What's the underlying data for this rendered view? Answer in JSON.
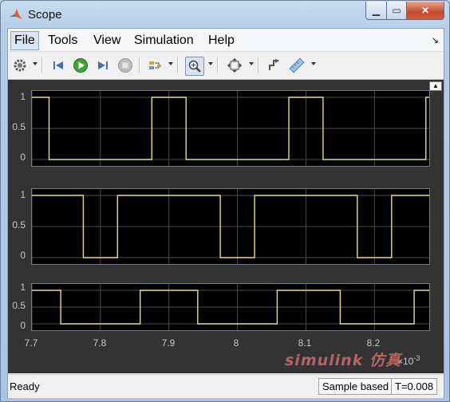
{
  "window": {
    "title": "Scope",
    "app_icon": "matlab-icon"
  },
  "menu": [
    "File",
    "Tools",
    "View",
    "Simulation",
    "Help"
  ],
  "toolbar": {
    "icons": [
      "gear-icon",
      "step-back-icon",
      "run-icon",
      "step-forward-icon",
      "stop-icon",
      "signal-icon",
      "zoom-in-icon",
      "autoscale-icon",
      "highlight-icon",
      "measure-icon"
    ]
  },
  "axes": {
    "y_ticks": [
      "1",
      "0.5",
      "0"
    ],
    "x_ticks": [
      "7.7",
      "7.8",
      "7.9",
      "8",
      "8.1",
      "8.2"
    ],
    "x_exponent": "×10",
    "x_exponent_power": "-3"
  },
  "colors": {
    "signal": "#e6df7a",
    "plot_bg": "#000000",
    "panel_bg": "#333333",
    "grid": "#4a4a4a"
  },
  "chart_data": [
    {
      "type": "line",
      "name": "",
      "x_unit": "1e-3 s",
      "xlim": [
        7.7,
        8.28
      ],
      "ylim": [
        0,
        1
      ],
      "x": [
        7.7,
        7.725,
        7.725,
        7.875,
        7.875,
        7.925,
        7.925,
        8.075,
        8.075,
        8.125,
        8.125,
        8.275,
        8.275,
        8.28
      ],
      "y": [
        1,
        1,
        0,
        0,
        1,
        1,
        0,
        0,
        1,
        1,
        0,
        0,
        1,
        1
      ]
    },
    {
      "type": "line",
      "name": "",
      "x_unit": "1e-3 s",
      "xlim": [
        7.7,
        8.28
      ],
      "ylim": [
        0,
        1
      ],
      "x": [
        7.7,
        7.775,
        7.775,
        7.825,
        7.825,
        7.975,
        7.975,
        8.025,
        8.025,
        8.175,
        8.175,
        8.225,
        8.225,
        8.28
      ],
      "y": [
        1,
        1,
        0,
        0,
        1,
        1,
        0,
        0,
        1,
        1,
        0,
        0,
        1,
        1
      ]
    },
    {
      "type": "line",
      "name": "",
      "x_unit": "1e-3 s",
      "xlim": [
        7.7,
        8.28
      ],
      "ylim": [
        0,
        1
      ],
      "x": [
        7.7,
        7.742,
        7.742,
        7.858,
        7.858,
        7.942,
        7.942,
        8.058,
        8.058,
        8.15,
        8.15,
        8.258,
        8.258,
        8.28
      ],
      "y": [
        1,
        1,
        0,
        0,
        1,
        1,
        0,
        0,
        1,
        1,
        0,
        0,
        1,
        1
      ]
    }
  ],
  "status": {
    "ready": "Ready",
    "mode": "Sample based",
    "time": "T=0.008"
  },
  "watermark": "simulink 仿真"
}
